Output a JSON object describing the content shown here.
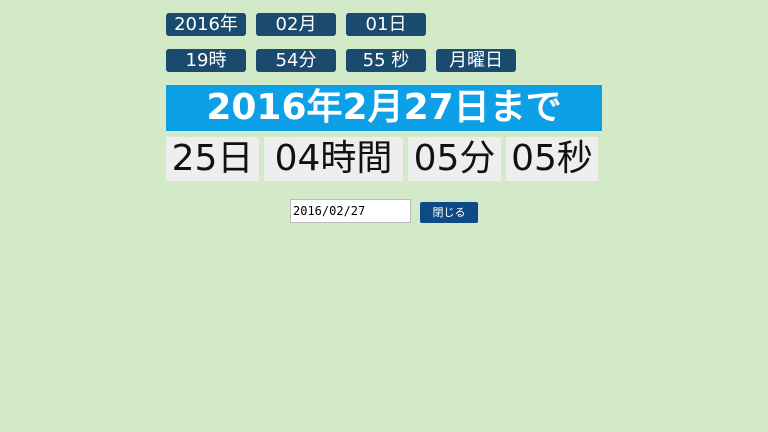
{
  "current": {
    "year": "2016年",
    "month": "02月",
    "day": "01日",
    "hour": "19時",
    "minute": "54分",
    "second": "55 秒",
    "weekday": "月曜日"
  },
  "target_banner": "2016年2月27日まで",
  "countdown": {
    "days": "25日",
    "hours": "04時間",
    "minutes": "05分",
    "seconds": "05秒"
  },
  "date_input": {
    "value": "2016/02/27"
  },
  "close_button": {
    "label": "閉じる"
  },
  "colors": {
    "background": "#d3eac8",
    "chip": "#1a4a6e",
    "banner": "#0da0e6",
    "countdown_cell": "#eeeeee",
    "button": "#0e4a86"
  }
}
